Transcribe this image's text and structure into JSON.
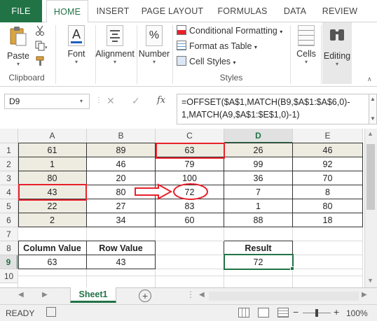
{
  "tabs": [
    {
      "label": "FILE"
    },
    {
      "label": "HOME"
    },
    {
      "label": "INSERT"
    },
    {
      "label": "PAGE LAYOUT"
    },
    {
      "label": "FORMULAS"
    },
    {
      "label": "DATA"
    },
    {
      "label": "REVIEW"
    }
  ],
  "ribbon": {
    "paste_label": "Paste",
    "clipboard_label": "Clipboard",
    "font_label": "Font",
    "alignment_label": "Alignment",
    "number_label": "Number",
    "conditional_formatting_label": "Conditional Formatting",
    "format_as_table_label": "Format as Table",
    "cell_styles_label": "Cell Styles",
    "styles_label": "Styles",
    "cells_label": "Cells",
    "editing_label": "Editing",
    "number_icon_text": "%",
    "font_icon_text": "A"
  },
  "formula_bar": {
    "name_box": "D9",
    "fx_label": "fx",
    "formula_line1": "=OFFSET($A$1,MATCH(B9,$A$1:$A$6,0)-",
    "formula_line2": "1,MATCH(A9,$A$1:$E$1,0)-1)"
  },
  "grid": {
    "columns": [
      "A",
      "B",
      "C",
      "D",
      "E"
    ],
    "rows": [
      "1",
      "2",
      "3",
      "4",
      "5",
      "6",
      "7",
      "8",
      "9",
      "10"
    ],
    "data": [
      [
        "61",
        "89",
        "63",
        "26",
        "46"
      ],
      [
        "1",
        "46",
        "79",
        "99",
        "92"
      ],
      [
        "80",
        "20",
        "100",
        "36",
        "70"
      ],
      [
        "43",
        "80",
        "72",
        "7",
        "8"
      ],
      [
        "22",
        "27",
        "83",
        "1",
        "80"
      ],
      [
        "2",
        "34",
        "60",
        "88",
        "18"
      ]
    ],
    "column_value_header": "Column Value",
    "row_value_header": "Row Value",
    "result_header": "Result",
    "column_value": "63",
    "row_value": "43",
    "result_value": "72"
  },
  "sheet_tab": "Sheet1",
  "status": {
    "ready": "READY",
    "zoom": "100%"
  },
  "colors": {
    "excel_green": "#217346",
    "highlight_red": "#e8212b",
    "header_fill": "#eeece1"
  }
}
